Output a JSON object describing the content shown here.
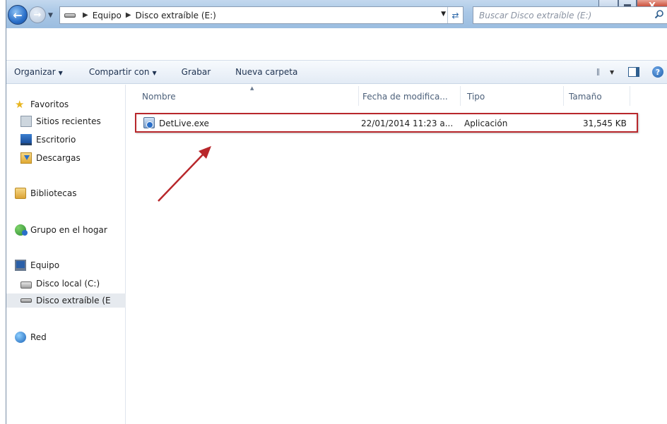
{
  "window": {
    "close_glyph": "X"
  },
  "nav": {
    "breadcrumb": [
      "Equipo",
      "Disco extraíble (E:)"
    ],
    "search_placeholder": "Buscar Disco extraíble (E:)"
  },
  "toolbar": {
    "organize": "Organizar",
    "share": "Compartir con",
    "burn": "Grabar",
    "new_folder": "Nueva carpeta"
  },
  "sidebar": {
    "favorites": "Favoritos",
    "recent": "Sitios recientes",
    "desktop": "Escritorio",
    "downloads": "Descargas",
    "libraries": "Bibliotecas",
    "homegroup": "Grupo en el hogar",
    "computer": "Equipo",
    "local_disk": "Disco local (C:)",
    "removable": "Disco extraíble (E",
    "network": "Red"
  },
  "columns": {
    "name": "Nombre",
    "date": "Fecha de modifica...",
    "type": "Tipo",
    "size": "Tamaño"
  },
  "files": [
    {
      "name": "DetLive.exe",
      "date": "22/01/2014 11:23 a...",
      "type": "Aplicación",
      "size": "31,545 KB"
    }
  ],
  "colors": {
    "highlight_border": "#b8272b",
    "annotation_arrow": "#b8272b"
  }
}
